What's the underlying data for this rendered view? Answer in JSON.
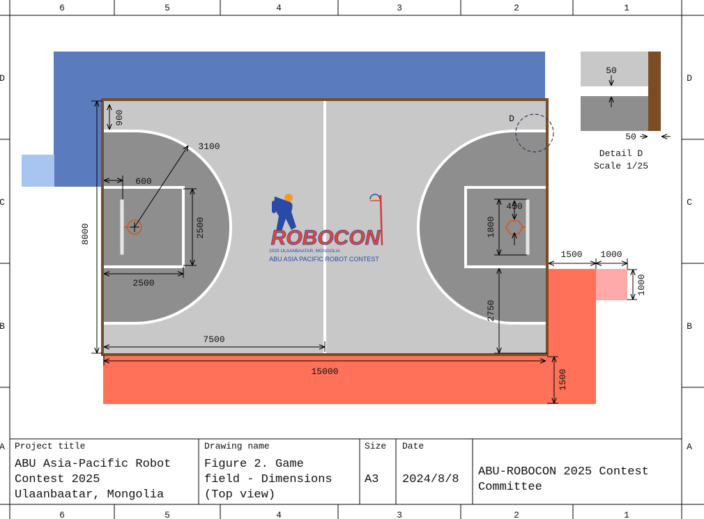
{
  "frame": {
    "columns": [
      "6",
      "5",
      "4",
      "3",
      "2",
      "1"
    ],
    "rows": [
      "D",
      "C",
      "B",
      "A"
    ]
  },
  "dimensions": {
    "d900": "900",
    "d3100": "3100",
    "d600": "600",
    "d2500v": "2500",
    "d2500h": "2500",
    "d8000": "8000",
    "d7500": "7500",
    "d15000": "15000",
    "d1500b": "1500",
    "d450": "450",
    "d1800": "1800",
    "d2750": "2750",
    "d1500r": "1500",
    "d1000h": "1000",
    "d1000v": "1000"
  },
  "detail": {
    "marker": "D",
    "d50_top": "50",
    "d50_right": "50",
    "title": "Detail D",
    "scale": "Scale 1/25"
  },
  "logo": {
    "wordmark": "ROBOCON",
    "city_line": "2025 ULAANBAATAR, MONGOLIA",
    "contest_line": "ABU ASIA PACIFIC ROBOT CONTEST"
  },
  "title_block": {
    "project_label": "Project title",
    "project_lines": [
      "ABU Asia-Pacific Robot",
      "Contest 2025",
      "Ulaanbaatar, Mongolia"
    ],
    "drawing_label": "Drawing name",
    "drawing_lines": [
      "Figure 2. Game",
      "field - Dimensions",
      "(Top view)"
    ],
    "size_label": "Size",
    "size_value": "A3",
    "date_label": "Date",
    "date_value": "2024/8/8",
    "committee_lines": [
      "ABU-ROBOCON 2025 Contest",
      "Committee"
    ]
  },
  "colors": {
    "blue_zone": "#5b7bbf",
    "light_blue_zone": "#a8c4f0",
    "red_zone": "#ff7158",
    "pink_zone": "#ffaaaa",
    "floor_light": "#c8c8c8",
    "floor_dark": "#8e8e8e",
    "frame_brown": "#7a4e24",
    "hoop_orange": "#d2561e"
  }
}
